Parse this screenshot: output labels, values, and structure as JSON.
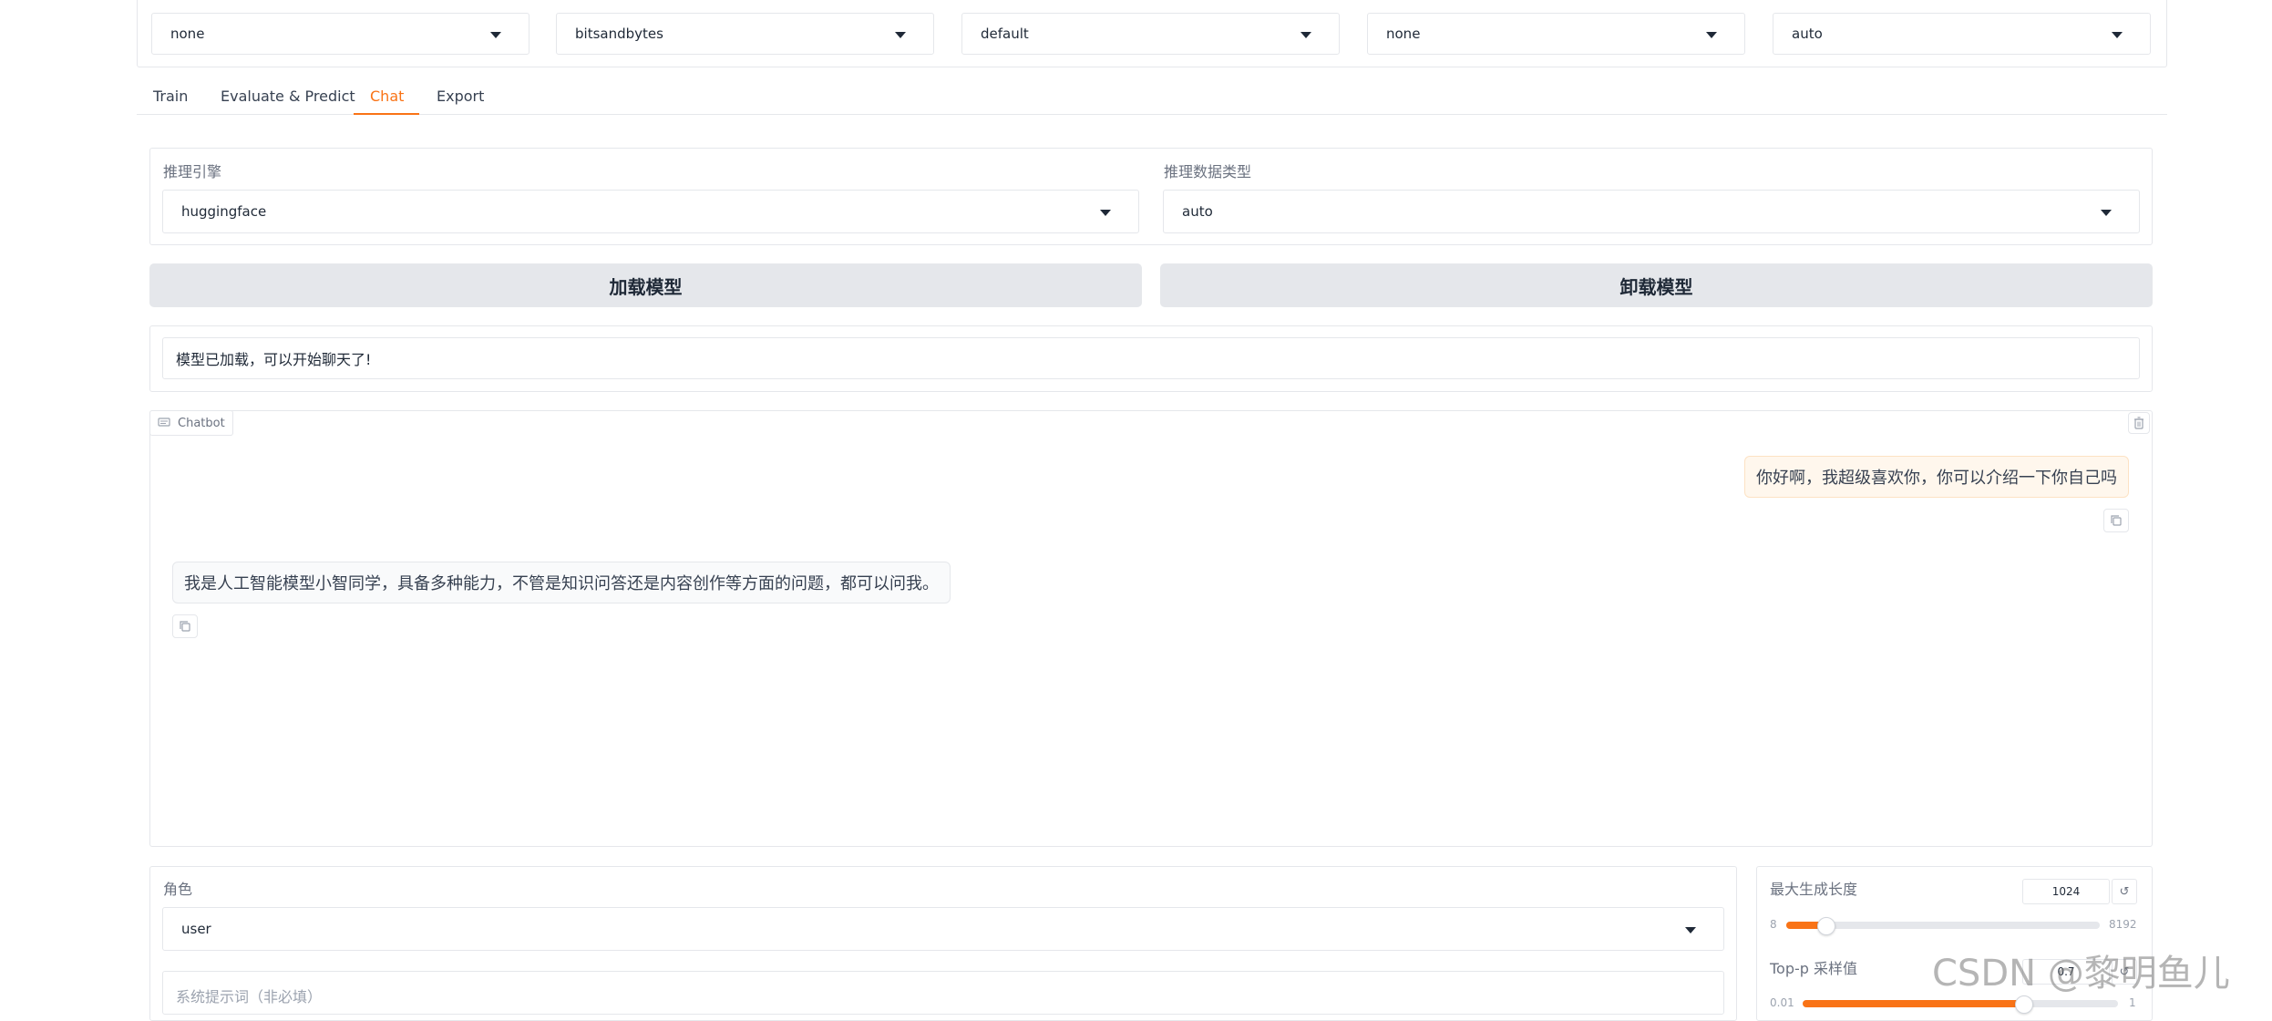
{
  "top_dropdowns": [
    {
      "value": "none"
    },
    {
      "value": "bitsandbytes"
    },
    {
      "value": "default"
    },
    {
      "value": "none"
    },
    {
      "value": "auto"
    }
  ],
  "tabs": [
    {
      "label": "Train"
    },
    {
      "label": "Evaluate & Predict"
    },
    {
      "label": "Chat",
      "active": true
    },
    {
      "label": "Export"
    }
  ],
  "infer": {
    "backend_label": "推理引擎",
    "backend_value": "huggingface",
    "dtype_label": "推理数据类型",
    "dtype_value": "auto"
  },
  "buttons": {
    "load": "加载模型",
    "unload": "卸载模型"
  },
  "status": {
    "message": "模型已加载，可以开始聊天了!"
  },
  "chatbot": {
    "label": "Chatbot",
    "messages": [
      {
        "role": "user",
        "text": "你好啊，我超级喜欢你，你可以介绍一下你自己吗"
      },
      {
        "role": "bot",
        "text": "我是人工智能模型小智同学，具备多种能力，不管是知识问答还是内容创作等方面的问题，都可以问我。"
      }
    ]
  },
  "role": {
    "label": "角色",
    "value": "user"
  },
  "system_prompt": {
    "placeholder": "系统提示词（非必填）"
  },
  "params": {
    "max_len": {
      "label": "最大生成长度",
      "value": "1024",
      "min": "8",
      "max": "8192",
      "fraction": 0.125
    },
    "top_p": {
      "label": "Top-p 采样值",
      "value": "0.7",
      "min": "0.01",
      "max": "1",
      "fraction": 0.7
    }
  },
  "watermark": "CSDN @黎明鱼儿",
  "colors": {
    "accent": "#f97316",
    "user_bubble_bg": "#fff7ed",
    "user_bubble_border": "#fde2c4"
  }
}
